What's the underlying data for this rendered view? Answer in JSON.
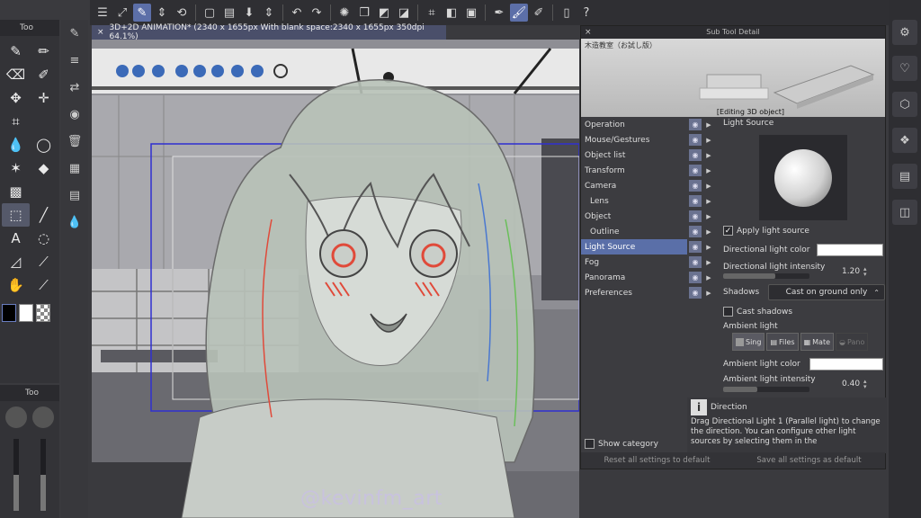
{
  "document": {
    "tab_title": "3D+2D ANIMATION* (2340 x 1655px With blank space:2340 x 1655px 350dpi 64.1%)",
    "close_glyph": "×"
  },
  "top_toolbar": {
    "icons": [
      "menu-icon",
      "fit-icon",
      "layer-edit-icon",
      "up-down-icon",
      "rotate-icon",
      "new-page-icon",
      "open-icon",
      "save-icon",
      "undo-redo-icon",
      "undo-icon",
      "redo-icon",
      "loading-icon",
      "copy-icon",
      "paste-icon",
      "fill-icon",
      "crop-icon",
      "mask-icon",
      "select-icon",
      "pen-tool-icon",
      "brush-tool-icon",
      "ruler-tool-icon",
      "phone-icon",
      "help-icon"
    ]
  },
  "tool_palette": {
    "header": "Too",
    "subtool_header": "Too"
  },
  "panel": {
    "title": "Sub Tool Detail",
    "close": "×",
    "preview_caption": "木造教室（お試し版）",
    "preview_mode": "[Editing 3D object]",
    "categories": [
      {
        "label": "Operation",
        "indent": false,
        "selected": false
      },
      {
        "label": "Mouse/Gestures",
        "indent": false,
        "selected": false
      },
      {
        "label": "Object list",
        "indent": false,
        "selected": false
      },
      {
        "label": "Transform",
        "indent": false,
        "selected": false
      },
      {
        "label": "Camera",
        "indent": false,
        "selected": false
      },
      {
        "label": "Lens",
        "indent": true,
        "selected": false
      },
      {
        "label": "Object",
        "indent": false,
        "selected": false
      },
      {
        "label": "Outline",
        "indent": true,
        "selected": false
      },
      {
        "label": "Light Source",
        "indent": false,
        "selected": true
      },
      {
        "label": "Fog",
        "indent": false,
        "selected": false
      },
      {
        "label": "Panorama",
        "indent": false,
        "selected": false
      },
      {
        "label": "Preferences",
        "indent": false,
        "selected": false
      }
    ],
    "section_title": "Light Source",
    "apply_light_source": {
      "label": "Apply light source",
      "checked": true
    },
    "directional_light_color": {
      "label": "Directional light color",
      "color": "#ffffff"
    },
    "directional_light_intensity": {
      "label": "Directional light intensity",
      "value": "1.20",
      "fill": 0.6
    },
    "shadows": {
      "label": "Shadows",
      "value": "Cast on ground only"
    },
    "cast_shadows": {
      "label": "Cast shadows",
      "checked": false
    },
    "ambient_light": {
      "label": "Ambient light",
      "options": [
        {
          "label": "Sing",
          "state": "on"
        },
        {
          "label": "Files",
          "state": "normal"
        },
        {
          "label": "Mate",
          "state": "normal"
        },
        {
          "label": "Pano",
          "state": "dim"
        }
      ]
    },
    "ambient_light_color": {
      "label": "Ambient light color",
      "color": "#ffffff"
    },
    "ambient_light_intensity": {
      "label": "Ambient light intensity",
      "value": "0.40",
      "fill": 0.4
    },
    "help": {
      "icon": "i",
      "title": "Direction",
      "text": "Drag Directional Light 1 (Parallel light) to change the direction. You can configure other light sources by selecting them in the"
    },
    "show_category": {
      "label": "Show category",
      "checked": false
    },
    "footer": {
      "reset": "Reset all settings to default",
      "save": "Save all settings as default"
    }
  },
  "watermark": "@kevinfm_art",
  "colors": {
    "accent": "#5a6fa8",
    "selection_rect": "#2f2fd0",
    "sketch_red": "#e04a3a",
    "sketch_blue": "#4a78d0",
    "sketch_green": "#6abf5a"
  }
}
